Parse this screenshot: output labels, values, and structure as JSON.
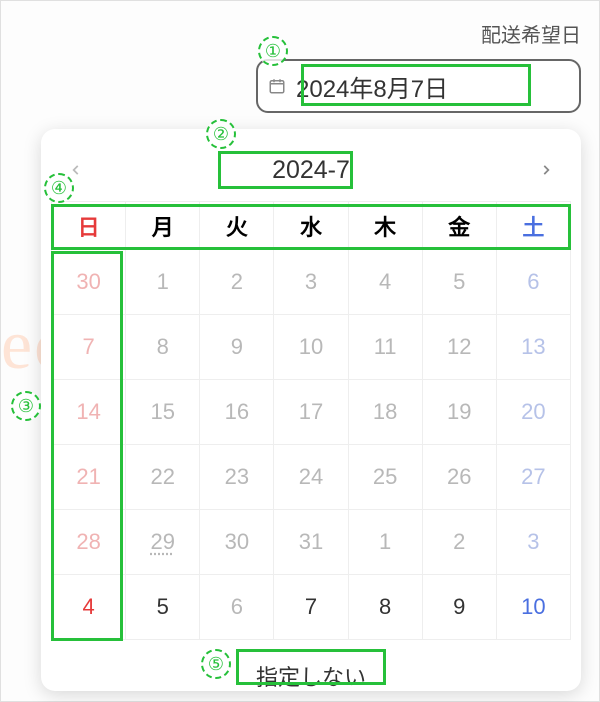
{
  "label": "配送希望日",
  "input": {
    "value": "2024年8月7日"
  },
  "calendar": {
    "month_label": "2024-7",
    "weekdays": [
      "日",
      "月",
      "火",
      "水",
      "木",
      "金",
      "土"
    ],
    "weeks": [
      [
        {
          "n": 30,
          "sun": true
        },
        {
          "n": 1
        },
        {
          "n": 2
        },
        {
          "n": 3
        },
        {
          "n": 4
        },
        {
          "n": 5
        },
        {
          "n": 6,
          "sat": true
        }
      ],
      [
        {
          "n": 7,
          "sun": true
        },
        {
          "n": 8
        },
        {
          "n": 9
        },
        {
          "n": 10
        },
        {
          "n": 11
        },
        {
          "n": 12
        },
        {
          "n": 13,
          "sat": true
        }
      ],
      [
        {
          "n": 14,
          "sun": true
        },
        {
          "n": 15
        },
        {
          "n": 16
        },
        {
          "n": 17
        },
        {
          "n": 18
        },
        {
          "n": 19
        },
        {
          "n": 20,
          "sat": true
        }
      ],
      [
        {
          "n": 21,
          "sun": true
        },
        {
          "n": 22
        },
        {
          "n": 23
        },
        {
          "n": 24
        },
        {
          "n": 25
        },
        {
          "n": 26
        },
        {
          "n": 27,
          "sat": true
        }
      ],
      [
        {
          "n": 28,
          "sun": true
        },
        {
          "n": 29,
          "today": true
        },
        {
          "n": 30
        },
        {
          "n": 31
        },
        {
          "n": 1
        },
        {
          "n": 2
        },
        {
          "n": 3,
          "sat": true
        }
      ],
      [
        {
          "n": 4,
          "sun": true,
          "cur": true
        },
        {
          "n": 5,
          "cur": true
        },
        {
          "n": 6
        },
        {
          "n": 7,
          "cur": true
        },
        {
          "n": 8,
          "cur": true
        },
        {
          "n": 9,
          "cur": true
        },
        {
          "n": 10,
          "sat": true,
          "cur": true
        }
      ]
    ],
    "no_specify": "指定しない"
  },
  "annotations": {
    "n1": "①",
    "n2": "②",
    "n3": "③",
    "n4": "④",
    "n5": "⑤"
  },
  "watermark": "ec-abc.com"
}
